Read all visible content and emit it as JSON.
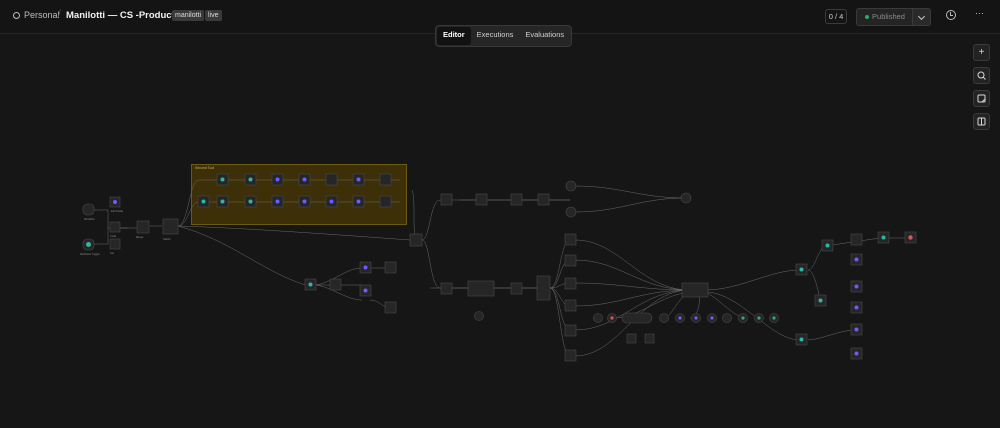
{
  "header": {
    "project": "Personal",
    "workflow_name": "Manilotti — CS -Production",
    "tags": [
      "manilotti",
      "live"
    ],
    "counter": "0 / 4",
    "publish_label": "Published"
  },
  "tabs": [
    {
      "label": "Editor",
      "active": true
    },
    {
      "label": "Executions",
      "active": false
    },
    {
      "label": "Evaluations",
      "active": false
    }
  ],
  "right_controls": {
    "add": "+",
    "zoom": "zoom",
    "sticky": "note",
    "panel": "panel"
  },
  "canvas": {
    "sticky_title": "Second Tool",
    "colors": {
      "background": "#161616",
      "sticky": "#3d3008",
      "active": "#2ea86b",
      "error": "#d9534f",
      "icon_purple": "#6b5cff",
      "icon_teal": "#2fb6a3"
    }
  }
}
